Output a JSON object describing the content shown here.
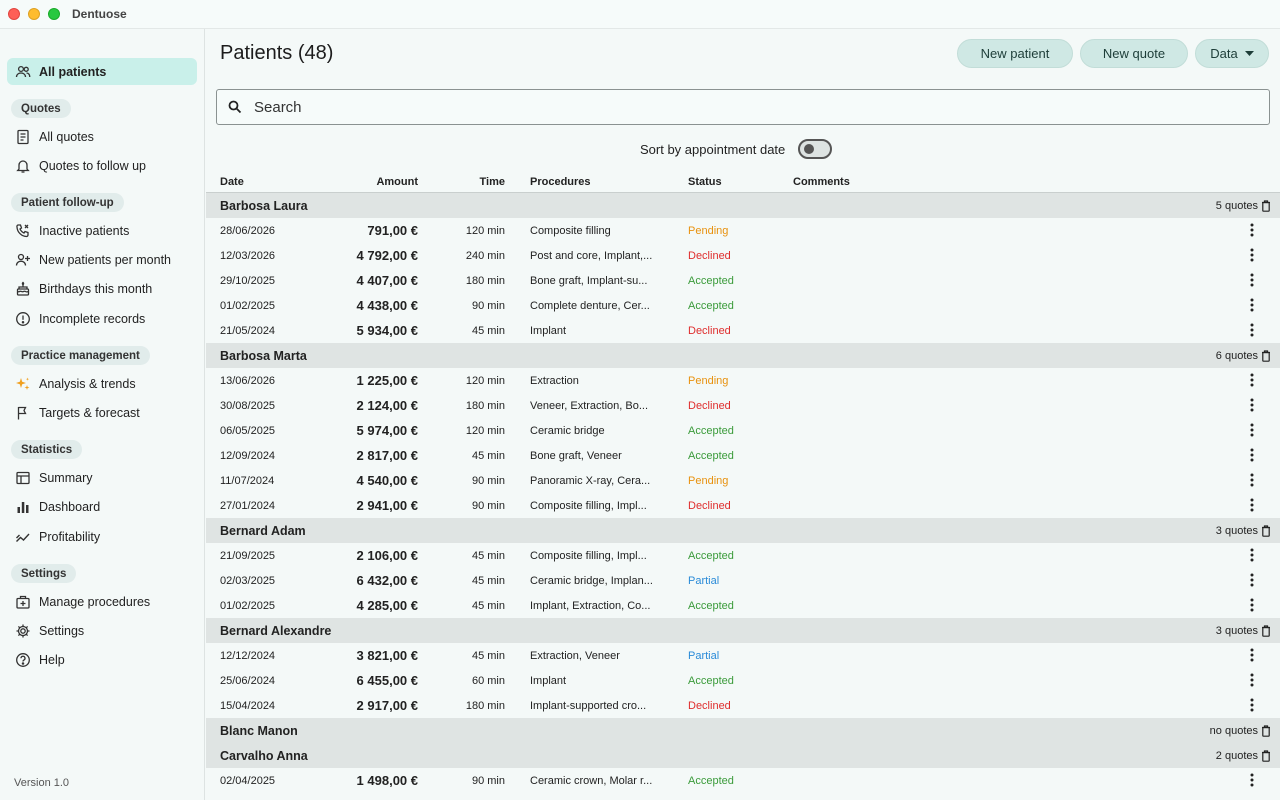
{
  "window": {
    "title": "Dentuose"
  },
  "sidebar": {
    "all_patients": "All patients",
    "sections": {
      "quotes": "Quotes",
      "patient_followup": "Patient follow-up",
      "practice_management": "Practice management",
      "statistics": "Statistics",
      "settings": "Settings"
    },
    "items": {
      "all_quotes": "All quotes",
      "quotes_follow_up": "Quotes to follow up",
      "inactive_patients": "Inactive patients",
      "new_patients_month": "New patients per month",
      "birthdays_month": "Birthdays this month",
      "incomplete_records": "Incomplete records",
      "analysis_trends": "Analysis & trends",
      "targets_forecast": "Targets & forecast",
      "summary": "Summary",
      "dashboard": "Dashboard",
      "profitability": "Profitability",
      "manage_procedures": "Manage procedures",
      "settings": "Settings",
      "help": "Help"
    },
    "version": "Version 1.0"
  },
  "header": {
    "title": "Patients (48)",
    "new_patient": "New patient",
    "new_quote": "New quote",
    "data": "Data"
  },
  "search": {
    "placeholder": "Search"
  },
  "sort": {
    "label": "Sort by appointment date"
  },
  "columns": {
    "date": "Date",
    "amount": "Amount",
    "time": "Time",
    "procedures": "Procedures",
    "status": "Status",
    "comments": "Comments"
  },
  "colors": {
    "accent": "#c9f0ea",
    "pending": "#e8920f",
    "declined": "#df2d2d",
    "accepted": "#3a9b3a",
    "partial": "#2a8bd8"
  },
  "groups": [
    {
      "name": "Barbosa Laura",
      "count": "5 quotes",
      "rows": [
        {
          "date": "28/06/2026",
          "amount": "791,00 €",
          "time": "120 min",
          "procedures": "Composite filling",
          "status": "Pending",
          "status_key": "pending"
        },
        {
          "date": "12/03/2026",
          "amount": "4 792,00 €",
          "time": "240 min",
          "procedures": "Post and core, Implant,...",
          "status": "Declined",
          "status_key": "declined"
        },
        {
          "date": "29/10/2025",
          "amount": "4 407,00 €",
          "time": "180 min",
          "procedures": "Bone graft, Implant-su...",
          "status": "Accepted",
          "status_key": "accepted"
        },
        {
          "date": "01/02/2025",
          "amount": "4 438,00 €",
          "time": "90 min",
          "procedures": "Complete denture, Cer...",
          "status": "Accepted",
          "status_key": "accepted"
        },
        {
          "date": "21/05/2024",
          "amount": "5 934,00 €",
          "time": "45 min",
          "procedures": "Implant",
          "status": "Declined",
          "status_key": "declined"
        }
      ]
    },
    {
      "name": "Barbosa Marta",
      "count": "6 quotes",
      "rows": [
        {
          "date": "13/06/2026",
          "amount": "1 225,00 €",
          "time": "120 min",
          "procedures": "Extraction",
          "status": "Pending",
          "status_key": "pending"
        },
        {
          "date": "30/08/2025",
          "amount": "2 124,00 €",
          "time": "180 min",
          "procedures": "Veneer, Extraction, Bo...",
          "status": "Declined",
          "status_key": "declined"
        },
        {
          "date": "06/05/2025",
          "amount": "5 974,00 €",
          "time": "120 min",
          "procedures": "Ceramic bridge",
          "status": "Accepted",
          "status_key": "accepted"
        },
        {
          "date": "12/09/2024",
          "amount": "2 817,00 €",
          "time": "45 min",
          "procedures": "Bone graft, Veneer",
          "status": "Accepted",
          "status_key": "accepted"
        },
        {
          "date": "11/07/2024",
          "amount": "4 540,00 €",
          "time": "90 min",
          "procedures": "Panoramic X-ray, Cera...",
          "status": "Pending",
          "status_key": "pending"
        },
        {
          "date": "27/01/2024",
          "amount": "2 941,00 €",
          "time": "90 min",
          "procedures": "Composite filling, Impl...",
          "status": "Declined",
          "status_key": "declined"
        }
      ]
    },
    {
      "name": "Bernard Adam",
      "count": "3 quotes",
      "rows": [
        {
          "date": "21/09/2025",
          "amount": "2 106,00 €",
          "time": "45 min",
          "procedures": "Composite filling, Impl...",
          "status": "Accepted",
          "status_key": "accepted"
        },
        {
          "date": "02/03/2025",
          "amount": "6 432,00 €",
          "time": "45 min",
          "procedures": "Ceramic bridge, Implan...",
          "status": "Partial",
          "status_key": "partial"
        },
        {
          "date": "01/02/2025",
          "amount": "4 285,00 €",
          "time": "45 min",
          "procedures": "Implant, Extraction, Co...",
          "status": "Accepted",
          "status_key": "accepted"
        }
      ]
    },
    {
      "name": "Bernard Alexandre",
      "count": "3 quotes",
      "rows": [
        {
          "date": "12/12/2024",
          "amount": "3 821,00 €",
          "time": "45 min",
          "procedures": "Extraction, Veneer",
          "status": "Partial",
          "status_key": "partial"
        },
        {
          "date": "25/06/2024",
          "amount": "6 455,00 €",
          "time": "60 min",
          "procedures": "Implant",
          "status": "Accepted",
          "status_key": "accepted"
        },
        {
          "date": "15/04/2024",
          "amount": "2 917,00 €",
          "time": "180 min",
          "procedures": "Implant-supported cro...",
          "status": "Declined",
          "status_key": "declined"
        }
      ]
    },
    {
      "name": "Blanc Manon",
      "count": "no quotes",
      "rows": []
    },
    {
      "name": "Carvalho Anna",
      "count": "2 quotes",
      "rows": [
        {
          "date": "02/04/2025",
          "amount": "1 498,00 €",
          "time": "90 min",
          "procedures": "Ceramic crown, Molar r...",
          "status": "Accepted",
          "status_key": "accepted"
        }
      ]
    }
  ]
}
